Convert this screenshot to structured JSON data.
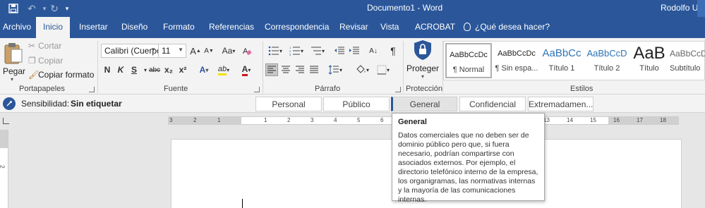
{
  "titlebar": {
    "document_title": "Documento1 - Word",
    "user_name": "Rodolfo Uma",
    "accent_color": "#2b579a"
  },
  "tabs": [
    {
      "label": "Archivo"
    },
    {
      "label": "Inicio",
      "active": true
    },
    {
      "label": "Insertar"
    },
    {
      "label": "Diseño"
    },
    {
      "label": "Formato"
    },
    {
      "label": "Referencias"
    },
    {
      "label": "Correspondencia"
    },
    {
      "label": "Revisar"
    },
    {
      "label": "Vista"
    },
    {
      "label": "ACROBAT"
    }
  ],
  "tell_me": "¿Qué desea hacer?",
  "clipboard": {
    "paste": "Pegar",
    "cut": "Cortar",
    "copy": "Copiar",
    "format_painter": "Copiar formato",
    "group_label": "Portapapeles"
  },
  "font": {
    "font_name": "Calibri (Cuerpo",
    "font_size": "11",
    "case_label": "Aa",
    "bold": "N",
    "italic": "K",
    "underline": "S",
    "strikethrough": "abc",
    "subscript": "x₂",
    "superscript": "x²",
    "effects": "A",
    "highlight": "ab",
    "font_color": "A",
    "grow": "A",
    "shrink": "A",
    "group_label": "Fuente"
  },
  "paragraph": {
    "group_label": "Párrafo",
    "show_marks": "¶"
  },
  "protection": {
    "protect": "Proteger",
    "group_label": "Protección"
  },
  "styles": {
    "group_label": "Estilos",
    "items": [
      {
        "sample": "AaBbCcDc",
        "name": "¶ Normal",
        "selected": true
      },
      {
        "sample": "AaBbCcDc",
        "name": "¶ Sin espa..."
      },
      {
        "sample": "AaBbCc",
        "name": "Título 1"
      },
      {
        "sample": "AaBbCcD",
        "name": "Título 2"
      },
      {
        "sample": "AaB",
        "name": "Título"
      },
      {
        "sample": "AaBbCcD",
        "name": "Subtítulo"
      }
    ]
  },
  "sensitivity": {
    "label": "Sensibilidad:",
    "value": "Sin etiquetar",
    "options": [
      "Personal",
      "Público",
      "General",
      "Confidencial",
      "Extremadamen..."
    ],
    "active": "General"
  },
  "ruler": {
    "numbers": [
      "3",
      "2",
      "1",
      "1",
      "2",
      "3",
      "4",
      "5",
      "6",
      "7",
      "8",
      "9",
      "10",
      "11",
      "12",
      "13",
      "14",
      "15",
      "16",
      "17",
      "18"
    ],
    "vertical_number": "2"
  },
  "tooltip": {
    "title": "General",
    "body": "Datos comerciales que no deben ser de dominio público pero que, si fuera necesario, podrían compartirse con asociados externos. Por ejemplo, el directorio telefónico interno de la empresa, los organigramas, las normativas internas y la mayoría de las comunicaciones internas."
  }
}
